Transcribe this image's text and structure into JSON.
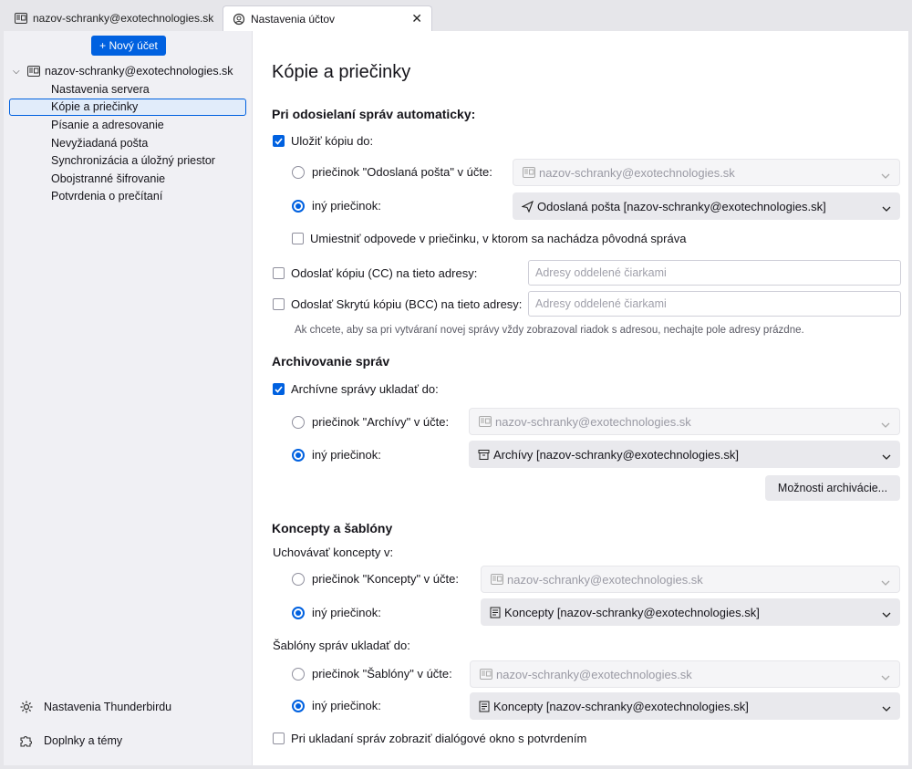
{
  "tabs": [
    {
      "label": "nazov-schranky@exotechnologies.sk",
      "icon": "mail-account-icon"
    },
    {
      "label": "Nastavenia účtov",
      "icon": "settings-icon",
      "close": "✕"
    }
  ],
  "sidebar": {
    "new_account": "+ Nový účet",
    "account": "nazov-schranky@exotechnologies.sk",
    "items": [
      "Nastavenia servera",
      "Kópie a priečinky",
      "Písanie a adresovanie",
      "Nevyžiadaná pošta",
      "Synchronizácia a úložný priestor",
      "Obojstranné šifrovanie",
      "Potvrdenia o prečítaní"
    ],
    "selected_index": 1,
    "footer": [
      {
        "label": "Nastavenia Thunderbirdu",
        "icon": "gear-icon"
      },
      {
        "label": "Doplnky a témy",
        "icon": "puzzle-icon"
      }
    ]
  },
  "main": {
    "title": "Kópie a priečinky",
    "sending": {
      "heading": "Pri odosielaní správ automaticky:",
      "save_copy": {
        "label": "Uložiť kópiu do:",
        "checked": true
      },
      "opt_sent": {
        "label": "priečinok \"Odoslaná pošta\" v účte:",
        "selected": false,
        "value": "nazov-schranky@exotechnologies.sk"
      },
      "opt_other": {
        "label": "iný priečinok:",
        "selected": true,
        "value": "Odoslaná pošta [nazov-schranky@exotechnologies.sk]"
      },
      "place_replies": {
        "label": "Umiestniť odpovede v priečinku, v ktorom sa nachádza pôvodná správa",
        "checked": false
      },
      "cc": {
        "label": "Odoslať kópiu (CC) na tieto adresy:",
        "checked": false,
        "placeholder": "Adresy oddelené čiarkami"
      },
      "bcc": {
        "label": "Odoslať Skrytú kópiu (BCC) na tieto adresy:",
        "checked": false,
        "placeholder": "Adresy oddelené čiarkami"
      },
      "note": "Ak chcete, aby sa pri vytváraní novej správy vždy zobrazoval riadok s adresou, nechajte pole adresy prázdne."
    },
    "archive": {
      "heading": "Archivovanie správ",
      "keep": {
        "label": "Archívne správy ukladať do:",
        "checked": true
      },
      "opt_account": {
        "label": "priečinok \"Archívy\" v účte:",
        "selected": false,
        "value": "nazov-schranky@exotechnologies.sk"
      },
      "opt_other": {
        "label": "iný priečinok:",
        "selected": true,
        "value": "Archívy [nazov-schranky@exotechnologies.sk]"
      },
      "options_button": "Možnosti archivácie..."
    },
    "drafts": {
      "heading": "Koncepty a šablóny",
      "drafts_label": "Uchovávať koncepty v:",
      "drafts_account": {
        "label": "priečinok \"Koncepty\" v účte:",
        "selected": false,
        "value": "nazov-schranky@exotechnologies.sk"
      },
      "drafts_other": {
        "label": "iný priečinok:",
        "selected": true,
        "value": "Koncepty [nazov-schranky@exotechnologies.sk]"
      },
      "templates_label": "Šablóny správ ukladať do:",
      "templates_account": {
        "label": "priečinok \"Šablóny\" v účte:",
        "selected": false,
        "value": "nazov-schranky@exotechnologies.sk"
      },
      "templates_other": {
        "label": "iný priečinok:",
        "selected": true,
        "value": "Koncepty [nazov-schranky@exotechnologies.sk]"
      },
      "confirm": {
        "label": "Pri ukladaní správ zobraziť dialógové okno s potvrdením",
        "checked": false
      }
    }
  },
  "colors": {
    "accent": "#0061e0",
    "sidebar_bg": "#f0f0f4",
    "selected_bg": "#e1ecfa"
  }
}
